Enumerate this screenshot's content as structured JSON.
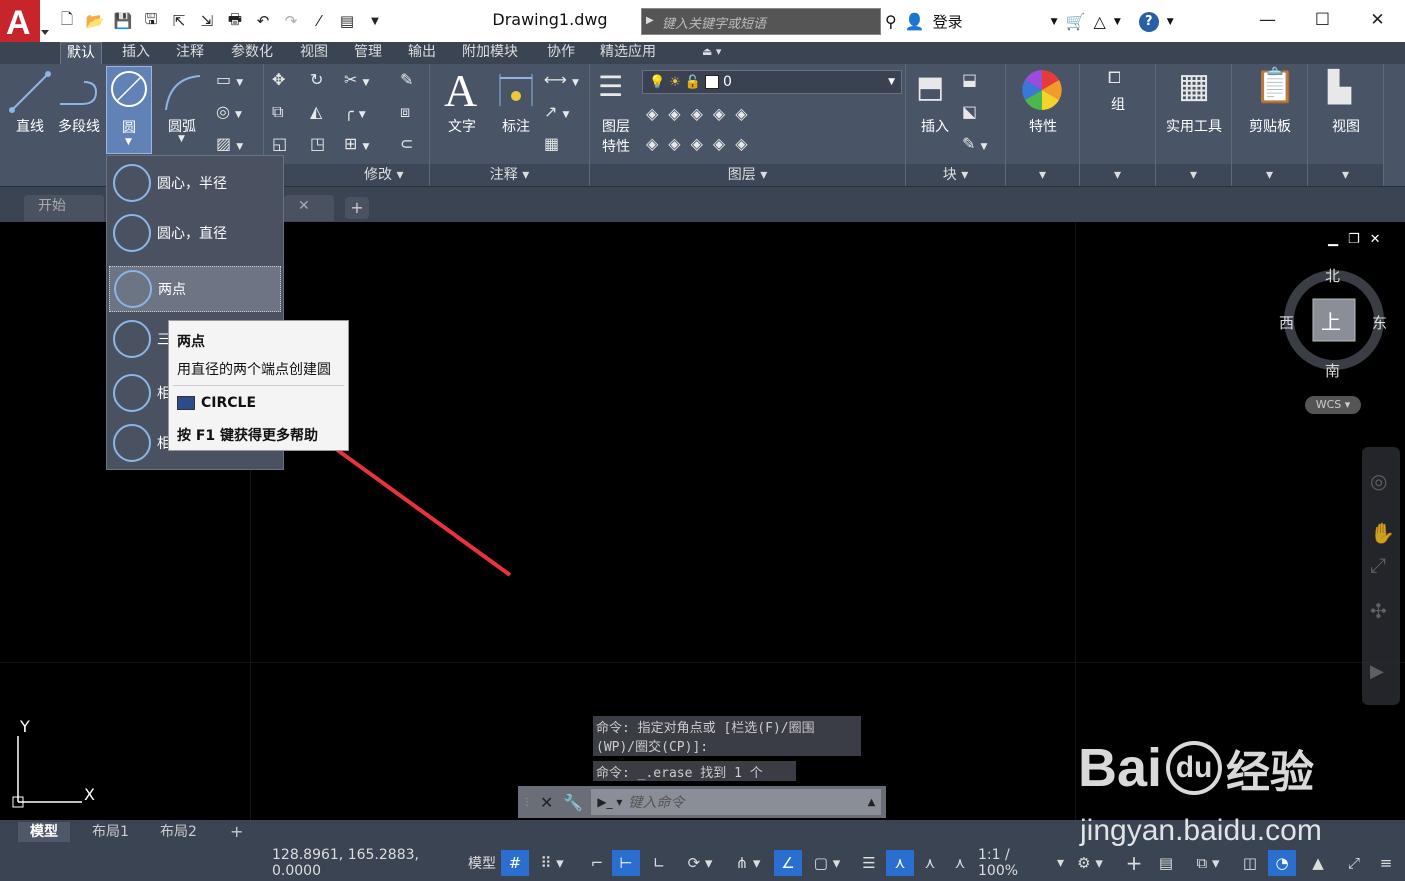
{
  "title_bar": {
    "document_title": "Drawing1.dwg",
    "search_placeholder": "键入关键字或短语",
    "login_label": "登录",
    "help_icon": "?"
  },
  "ribbon_tabs": [
    "默认",
    "插入",
    "注释",
    "参数化",
    "视图",
    "管理",
    "输出",
    "附加模块",
    "协作",
    "精选应用"
  ],
  "ribbon": {
    "draw": {
      "line": "直线",
      "polyline": "多段线",
      "circle": "圆",
      "arc": "圆弧"
    },
    "modify_title": "修改 ▾",
    "annotation": {
      "text": "文字",
      "dim": "标注",
      "title": "注释 ▾"
    },
    "layers": {
      "props": "图层\n特性",
      "props_line1": "图层",
      "props_line2": "特性",
      "current_layer": "0",
      "title": "图层 ▾"
    },
    "block": {
      "insert": "插入",
      "title": "块 ▾"
    },
    "properties": "特性",
    "groups": "组",
    "utilities": "实用工具",
    "clipboard": "剪贴板",
    "view": "视图"
  },
  "file_tabs": {
    "start": "开始"
  },
  "circle_menu": [
    {
      "label": "圆心，半径"
    },
    {
      "label": "圆心，直径"
    },
    {
      "label": "两点"
    },
    {
      "label": "三"
    },
    {
      "label": "相"
    },
    {
      "label": "相"
    }
  ],
  "tooltip": {
    "title": "两点",
    "desc": "用直径的两个端点创建圆",
    "command": "CIRCLE",
    "help": "按 F1 键获得更多帮助"
  },
  "viewcube": {
    "north": "北",
    "south": "南",
    "east": "东",
    "west": "西",
    "face": "上",
    "wcs": "WCS"
  },
  "command_history": [
    "命令: 指定对角点或 [栏选(F)/圈围",
    "(WP)/圈交(CP)]:",
    "命令: _.erase 找到 1 个"
  ],
  "command_placeholder": "键入命令",
  "ucs": {
    "x": "X",
    "y": "Y"
  },
  "layout_tabs": [
    "模型",
    "布局1",
    "布局2"
  ],
  "status": {
    "coords": "128.8961, 165.2883, 0.0000",
    "model": "模型",
    "scale": "1:1 / 100%"
  },
  "watermark": {
    "brand": "Bai",
    "brand2": "du",
    "jy": "经验",
    "url": "jingyan.baidu.com"
  }
}
